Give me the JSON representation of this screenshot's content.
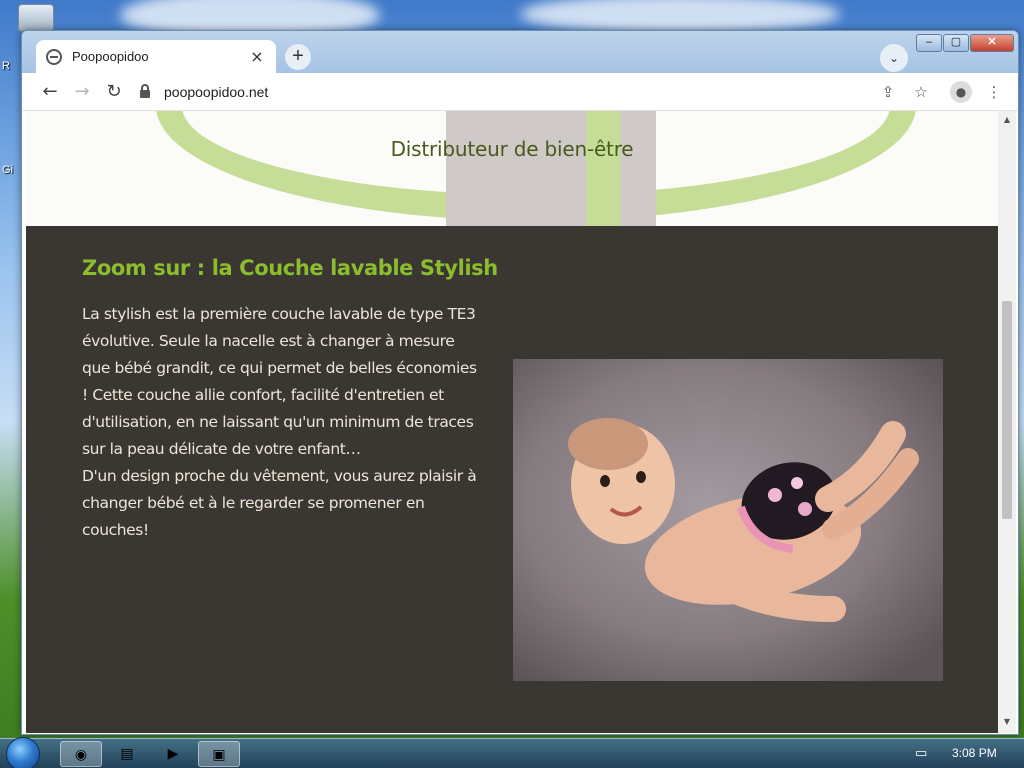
{
  "browser": {
    "tab": {
      "title": "Poopoopidoo",
      "close": "×"
    },
    "new_tab": "+",
    "tab_search": "⌄",
    "window_controls": {
      "minimize": "–",
      "maximize": "▢",
      "close": "✕"
    },
    "nav": {
      "back": "←",
      "forward": "→",
      "reload": "↻"
    },
    "address": {
      "url": "poopoopidoo.net"
    },
    "toolbar_icons": {
      "share": "⇪",
      "bookmark": "☆",
      "menu": "⋮"
    }
  },
  "page": {
    "tagline": "Distributeur de bien-être",
    "section": {
      "heading": "Zoom sur : la Couche lavable Stylish",
      "paragraph_1": "La stylish est la première couche lavable de type TE3 évolutive. Seule la nacelle est à changer à mesure que bébé grandit, ce qui permet de belles économies ! Cette couche allie confort, facilité d'entretien et d'utilisation, en ne laissant qu'un minimum de traces sur la peau délicate de votre enfant…",
      "paragraph_2": "D'un design proche du vêtement, vous aurez plaisir à changer bébé et à le regarder se promener en couches!"
    },
    "colors": {
      "heading_green": "#8cbd2e",
      "section_bg": "#3a3631",
      "tagline": "#4a5a1c"
    }
  },
  "taskbar": {
    "clock": "3:08 PM"
  },
  "desktop": {
    "labels": [
      "R",
      "Gi"
    ]
  }
}
